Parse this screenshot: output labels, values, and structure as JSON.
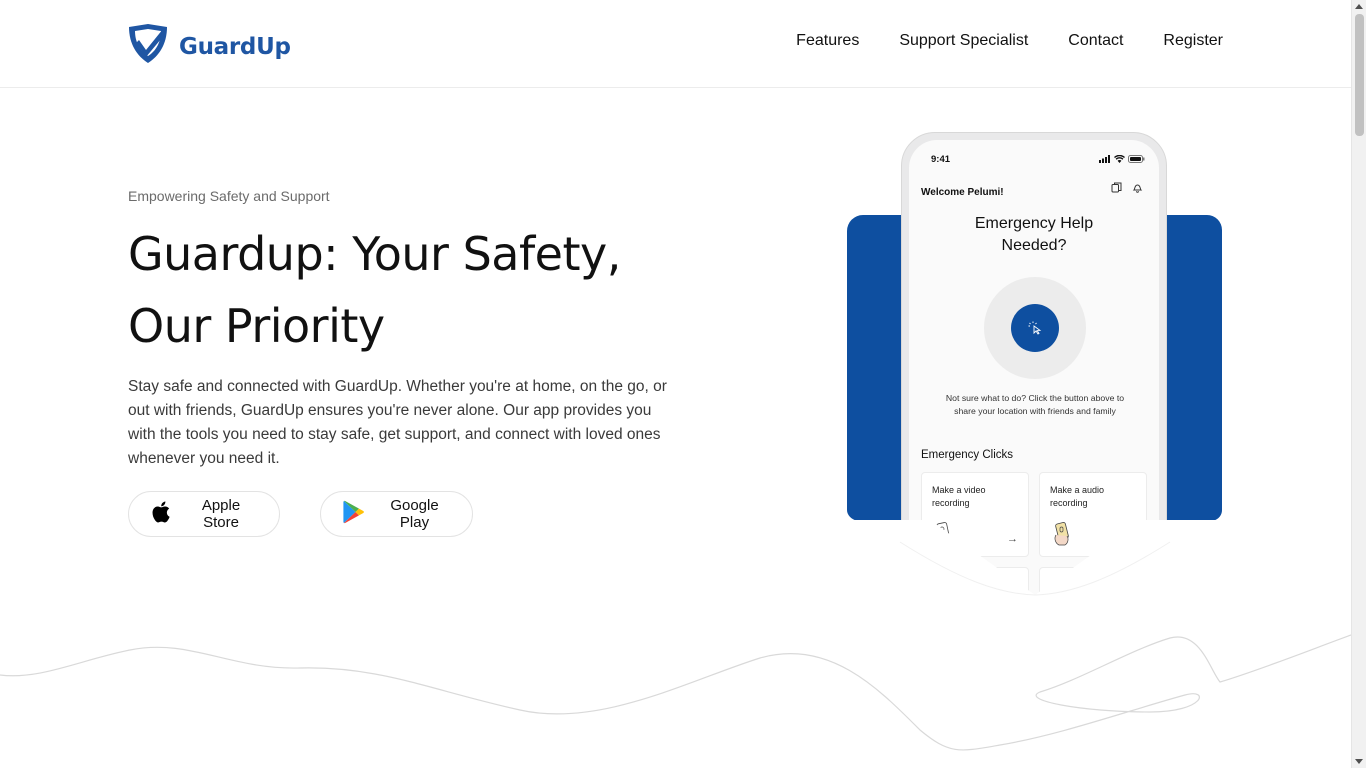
{
  "brand": {
    "name": "GuardUp",
    "color": "#1f56a3",
    "logo_icon": "shield-check-icon"
  },
  "nav": {
    "items": [
      "Features",
      "Support Specialist",
      "Contact",
      "Register"
    ]
  },
  "hero": {
    "eyebrow": "Empowering Safety and Support",
    "title_line1": "Guardup: Your Safety,",
    "title_line2": "Our Priority",
    "description": "Stay safe and connected with GuardUp. Whether you're at home, on the go, or out with friends, GuardUp ensures you're never alone. Our app provides you with the tools you need to stay safe, get support, and connect with loved ones whenever you need it.",
    "buttons": [
      {
        "label": "Apple Store",
        "icon": "apple-icon"
      },
      {
        "label": "Google Play",
        "icon": "google-play-icon"
      }
    ]
  },
  "phone": {
    "time": "9:41",
    "welcome": "Welcome Pelumi!",
    "emergency_title_line1": "Emergency Help",
    "emergency_title_line2": "Needed?",
    "hint": "Not sure what to do? Click the button above to share your location with friends and family",
    "section_title": "Emergency Clicks",
    "cards": [
      {
        "label": "Make a video recording",
        "arrow": "→"
      },
      {
        "label": "Make a audio recording",
        "arrow": "→"
      }
    ],
    "accent_color": "#0e4fa0"
  },
  "colors": {
    "accent": "#0e4fa0",
    "text": "#111111",
    "muted": "#6b6b6b"
  }
}
